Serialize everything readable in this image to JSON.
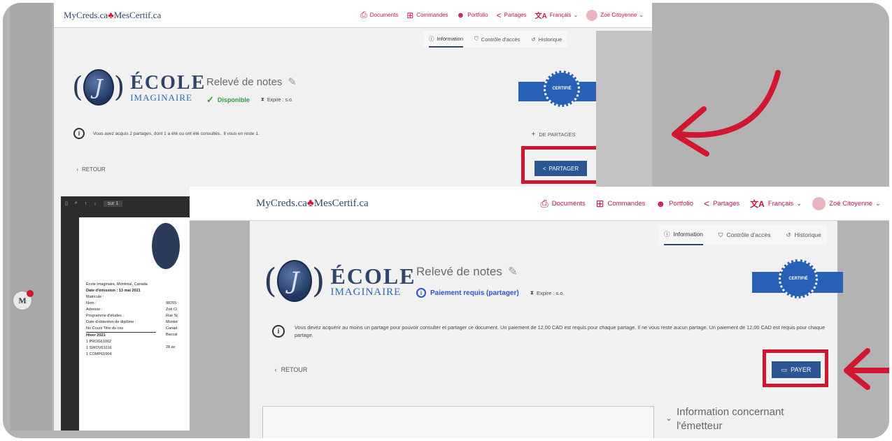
{
  "colors": {
    "brand": "#31456a",
    "nav": "#c4163d",
    "primary": "#2a5691",
    "highlight": "#d0172f",
    "ok": "#2e9c44",
    "warn": "#2b55c9"
  },
  "back": {
    "brand": {
      "left": "MyCreds.ca",
      "leaf": "♣",
      "right": "MesCertif.ca"
    },
    "nav": [
      "Documents",
      "Commandes",
      "Portfolio",
      "Partages",
      "Français",
      "Zoé Citoyenne"
    ],
    "tabs": [
      "Information",
      "Contrôle d'accès",
      "Historique"
    ],
    "school": {
      "line1": "ÉCOLE",
      "line2": "IMAGINAIRE",
      "monogram": "J"
    },
    "doc_title": "Relevé de notes",
    "status": "Disponible",
    "expire": "Expire : s.o.",
    "ribbon": "CERTIFIÉ",
    "info_text": "Vous avez acquis 2 partages, dont 1 a été ou ont été consultés.. Il vous en reste 1.",
    "more_shares": "DE PARTAGES",
    "back_button": "RETOUR",
    "share_button": "PARTAGER",
    "pdf": {
      "page": "sur 1",
      "lines": [
        "École Imaginaire, Montréal, Canada",
        "Date d'émission : 13 mai 2021",
        "",
        "Matricule :",
        "Nom :",
        "Adresse :",
        "",
        "",
        "Programme d'études :",
        "",
        "Date d'obtention de diplôme :",
        "",
        "",
        "No Cours     Titre du cou",
        "",
        "Hiver 2021",
        "1     PROG61002",
        "1     SWOV61016",
        "1     COMP61004"
      ],
      "right_col": [
        "98765",
        "Zoé Ci",
        "Rue St",
        "Montré",
        "Canad",
        "Baccal",
        "28 av"
      ]
    }
  },
  "front": {
    "brand": {
      "left": "MyCreds.ca",
      "leaf": "♣",
      "right": "MesCertif.ca"
    },
    "nav": [
      "Documents",
      "Commandes",
      "Portfolio",
      "Partages",
      "Français",
      "Zoé Citoyenne"
    ],
    "tabs": [
      "Information",
      "Contrôle d'accès",
      "Historique"
    ],
    "school": {
      "line1": "ÉCOLE",
      "line2": "IMAGINAIRE",
      "monogram": "J"
    },
    "doc_title": "Relevé de notes",
    "status": "Paiement requis (partager)",
    "expire": "Expire : s.o.",
    "ribbon": "CERTIFIÉ",
    "info_text": "Vous devez acquérir au moins un partage pour pouvoir consulter et partager ce document. Un paiement de 12,00 CAD est requis pour chaque partage. Il ne vous reste aucun partage. Un paiement de 12,00 CAD est requis pour chaque partage.",
    "back_button": "RETOUR",
    "pay_button": "PAYER",
    "issuer_heading": "Information concernant l'émetteur"
  }
}
